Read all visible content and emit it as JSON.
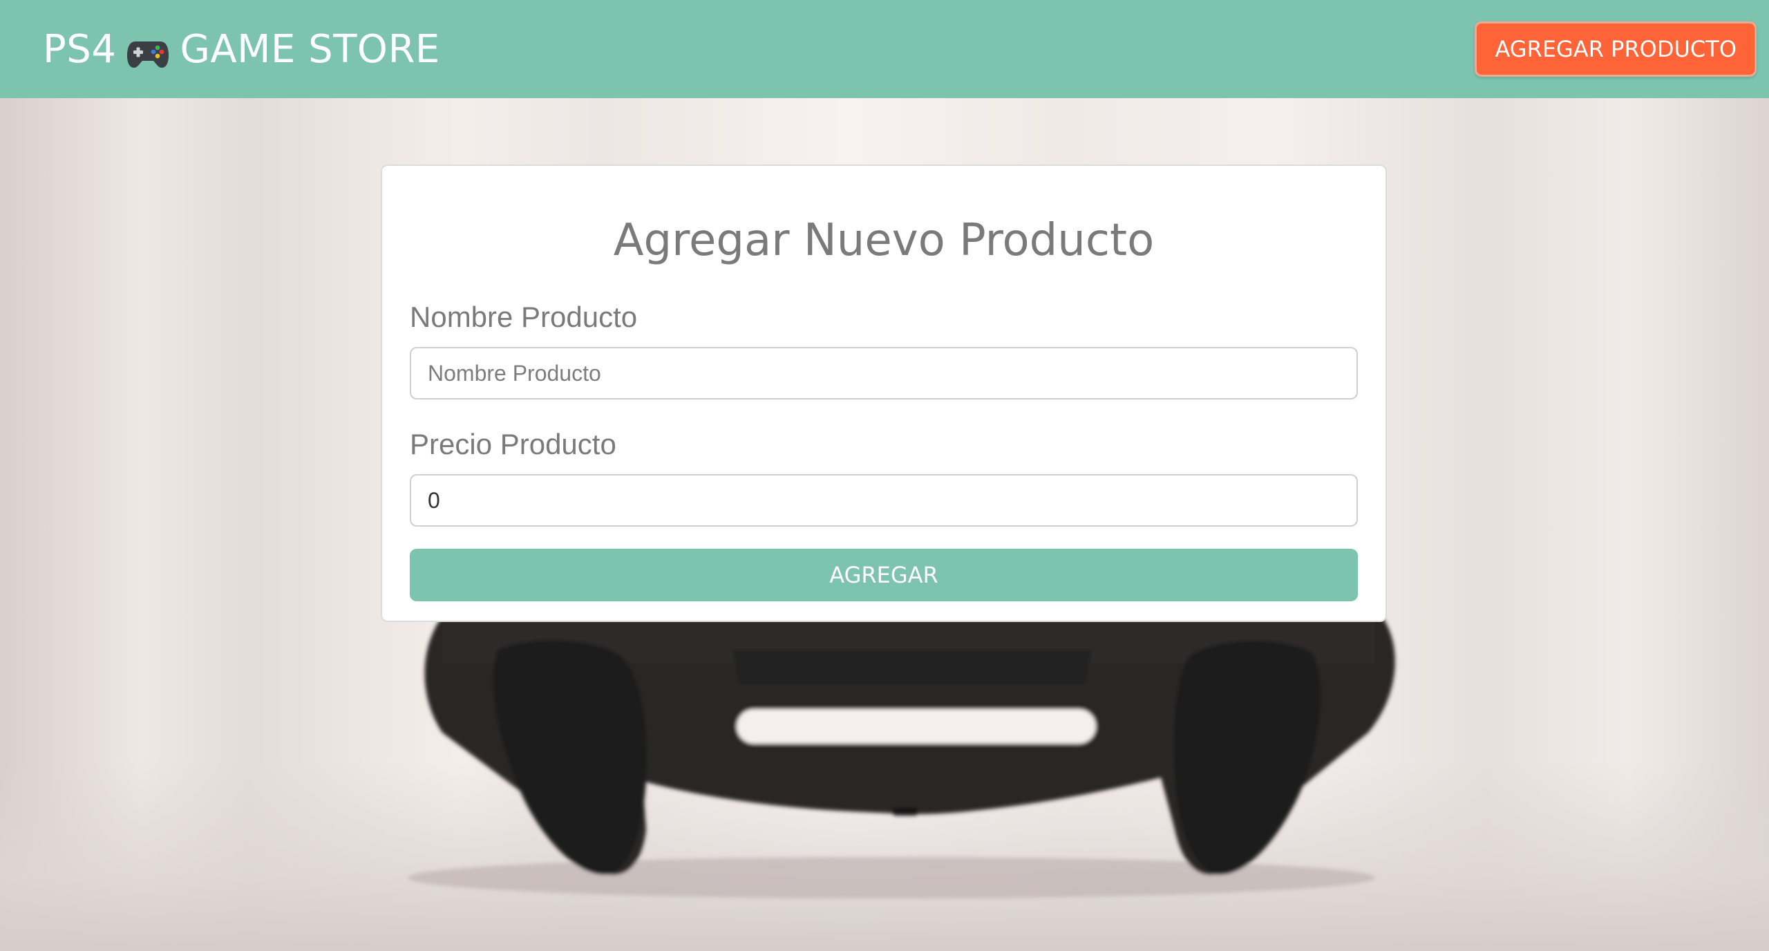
{
  "navbar": {
    "brand_prefix": "PS4",
    "brand_suffix": "GAME STORE",
    "brand_icon": "gamepad-icon",
    "add_product_label": "AGREGAR PRODUCTO"
  },
  "form": {
    "title": "Agregar Nuevo Producto",
    "name_label": "Nombre Producto",
    "name_placeholder": "Nombre Producto",
    "name_value": "",
    "price_label": "Precio Producto",
    "price_value": "0",
    "submit_label": "AGREGAR"
  },
  "colors": {
    "navbar": "#7dc4af",
    "accent_button": "#ff6338",
    "submit_button": "#7dc4af"
  }
}
